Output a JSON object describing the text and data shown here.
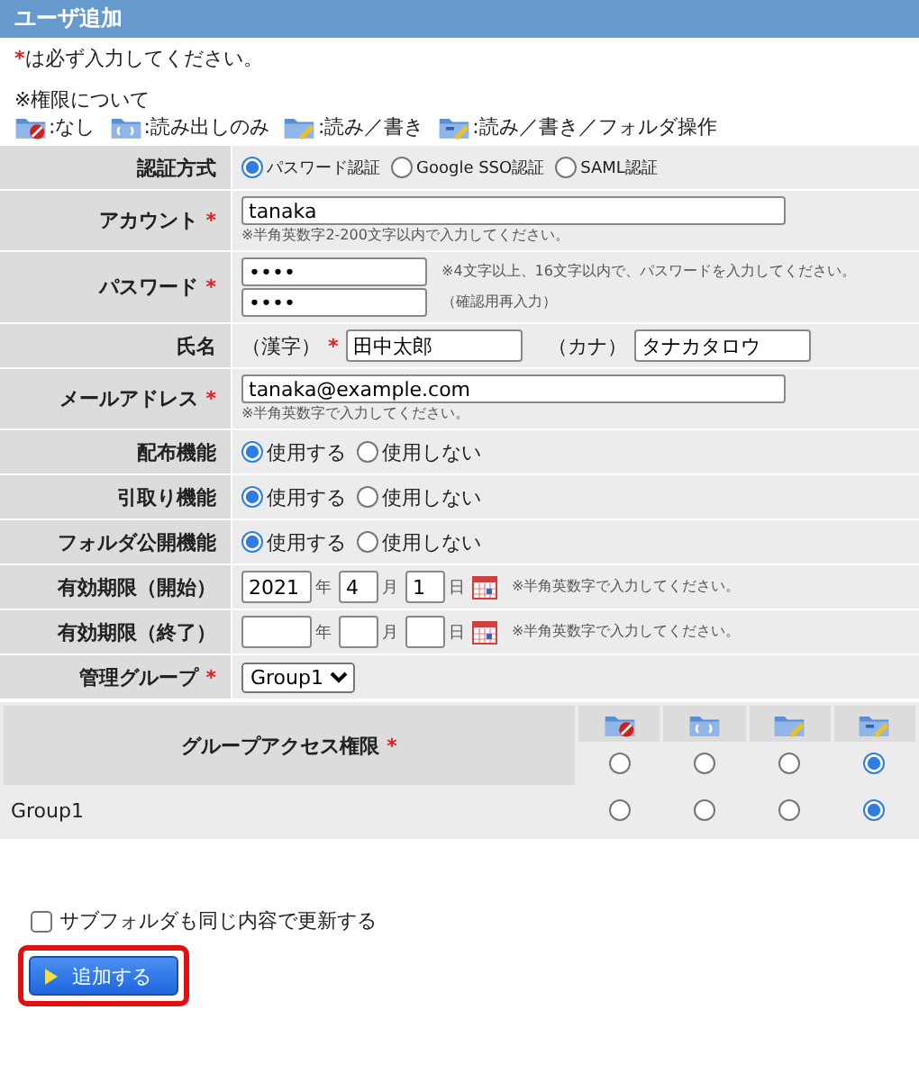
{
  "header": {
    "title": "ユーザ追加"
  },
  "required_note": {
    "mark": "*",
    "text": "は必ず入力してください。"
  },
  "permission_legend": {
    "title": "※権限について",
    "items": [
      {
        "kind": "none",
        "label": ":なし"
      },
      {
        "kind": "read",
        "label": ":読み出しのみ"
      },
      {
        "kind": "write",
        "label": ":読み／書き"
      },
      {
        "kind": "folder",
        "label": ":読み／書き／フォルダ操作"
      }
    ]
  },
  "form": {
    "rows": [
      {
        "kind": "radio",
        "label": "認証方式",
        "required": false,
        "small": true,
        "options": [
          {
            "label": "パスワード認証",
            "selected": true
          },
          {
            "label": "Google SSO認証",
            "selected": false
          },
          {
            "label": "SAML認証",
            "selected": false
          }
        ]
      },
      {
        "kind": "text",
        "label": "アカウント",
        "required": true,
        "value": "tanaka",
        "note": "※半角英数字2-200文字以内で入力してください。"
      },
      {
        "kind": "password",
        "label": "パスワード",
        "required": true,
        "value": "••••",
        "note": "※4文字以上、16文字以内で、パスワードを入力してください。",
        "confirm_value": "••••",
        "confirm_note": "（確認用再入力）"
      },
      {
        "kind": "name",
        "label": "氏名",
        "required": false,
        "kanji_label": "（漢字）",
        "kanji_required": true,
        "kanji_value": "田中太郎",
        "kana_label": "（カナ）",
        "kana_value": "タナカタロウ"
      },
      {
        "kind": "text",
        "label": "メールアドレス",
        "required": true,
        "value": "tanaka@example.com",
        "note": "※半角英数字で入力してください。"
      },
      {
        "kind": "radio",
        "label": "配布機能",
        "required": false,
        "small": false,
        "options": [
          {
            "label": "使用する",
            "selected": true
          },
          {
            "label": "使用しない",
            "selected": false
          }
        ]
      },
      {
        "kind": "radio",
        "label": "引取り機能",
        "required": false,
        "small": false,
        "options": [
          {
            "label": "使用する",
            "selected": true
          },
          {
            "label": "使用しない",
            "selected": false
          }
        ]
      },
      {
        "kind": "radio",
        "label": "フォルダ公開機能",
        "required": false,
        "small": false,
        "options": [
          {
            "label": "使用する",
            "selected": true
          },
          {
            "label": "使用しない",
            "selected": false
          }
        ]
      },
      {
        "kind": "date",
        "label": "有効期限（開始）",
        "required": false,
        "year": "2021",
        "month": "4",
        "day": "1",
        "year_unit": "年",
        "month_unit": "月",
        "day_unit": "日",
        "note": "※半角英数字で入力してください。"
      },
      {
        "kind": "date",
        "label": "有効期限（終了）",
        "required": false,
        "year_unit": "年",
        "month_unit": "月",
        "day_unit": "日",
        "note": "※半角英数字で入力してください。"
      },
      {
        "kind": "select",
        "label": "管理グループ",
        "required": true,
        "value": "Group1"
      }
    ]
  },
  "access": {
    "title": "グループアクセス権限",
    "required": true,
    "levels": [
      {
        "kind": "none"
      },
      {
        "kind": "read"
      },
      {
        "kind": "write"
      },
      {
        "kind": "folder"
      }
    ],
    "header_options": [
      {
        "selected": false
      },
      {
        "selected": false
      },
      {
        "selected": false
      },
      {
        "selected": true
      }
    ],
    "groups": [
      {
        "name": "Group1",
        "options": [
          {
            "selected": false
          },
          {
            "selected": false
          },
          {
            "selected": false
          },
          {
            "selected": true
          }
        ]
      }
    ]
  },
  "subfolder_checkbox": {
    "label": "サブフォルダも同じ内容で更新する",
    "checked": false
  },
  "submit_button": {
    "label": "追加する",
    "highlighted": true
  }
}
